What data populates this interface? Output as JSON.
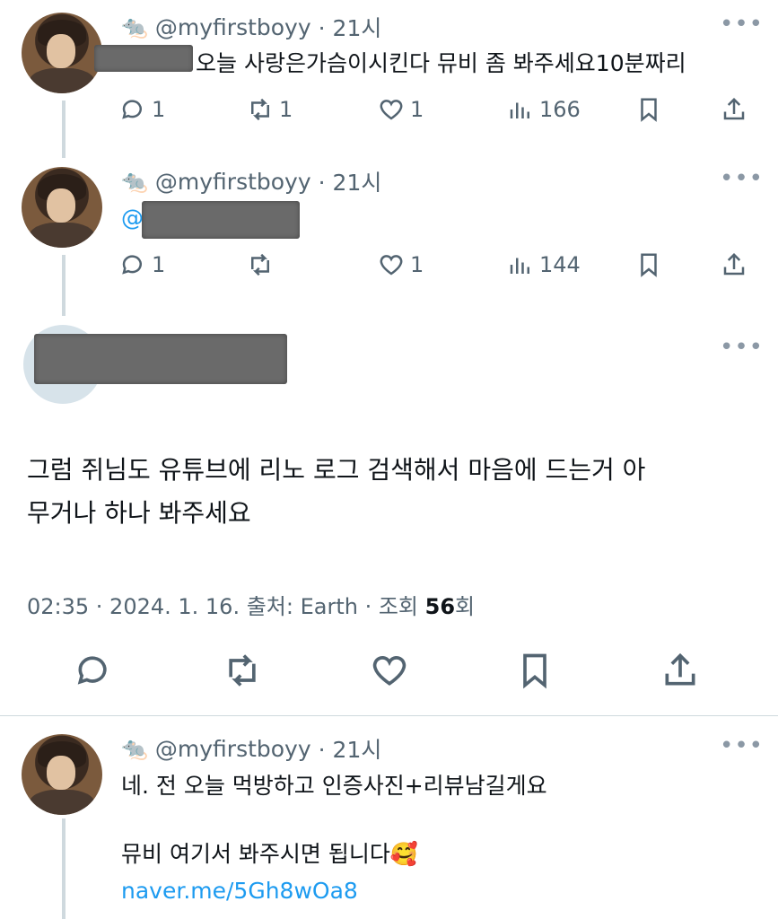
{
  "tweets": [
    {
      "emoji": "🐀",
      "handle": "@myfirstboyy",
      "time": "· 21시",
      "text": "오늘 사랑은가슴이시킨다 뮤비 좀 봐주세요10분짜리",
      "replies": "1",
      "retweets": "1",
      "likes": "1",
      "views": "166"
    },
    {
      "emoji": "🐀",
      "handle": "@myfirstboyy",
      "time": "· 21시",
      "mention_prefix": "@",
      "replies": "1",
      "retweets": "",
      "likes": "1",
      "views": "144"
    }
  ],
  "main_tweet": {
    "text_line1": "그럼 쥐님도 유튜브에 리노 로그 검색해서 마음에 드는거 아",
    "text_line2": "무거나 하나 봐주세요",
    "meta_prefix": "02:35 · 2024. 1. 16. 출처: Earth · 조회 ",
    "views_count": "56",
    "views_suffix": "회"
  },
  "reply_tweet": {
    "emoji": "🐀",
    "handle": "@myfirstboyy",
    "time": "· 21시",
    "line1": "네. 전 오늘 먹방하고 인증사진+리뷰남길게요",
    "line2": "뮤비 여기서 봐주시면 됩니다",
    "line2_emoji": "🥰",
    "link": "naver.me/5Gh8wOa8"
  },
  "more_icon": "•••",
  "colors": {
    "link": "#1d9bf0",
    "muted": "#536471",
    "text": "#0f1419"
  }
}
